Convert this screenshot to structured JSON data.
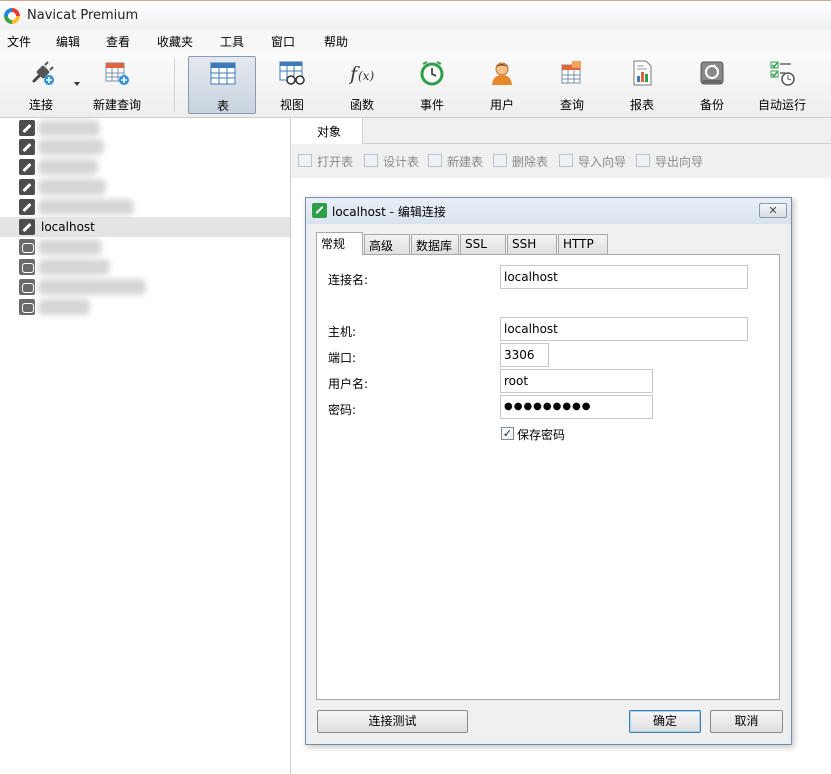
{
  "window": {
    "title": "Navicat Premium"
  },
  "menu": [
    "文件",
    "编辑",
    "查看",
    "收藏夹",
    "工具",
    "窗口",
    "帮助"
  ],
  "toolbar": {
    "connect": "连接",
    "new_query": "新建查询",
    "table": "表",
    "view": "视图",
    "function": "函数",
    "event": "事件",
    "user": "用户",
    "query": "查询",
    "report": "报表",
    "backup": "备份",
    "auto_run": "自动运行",
    "active": "表"
  },
  "tree": {
    "selected_label": "localhost"
  },
  "objects": {
    "tab": "对象",
    "tools": [
      "打开表",
      "设计表",
      "新建表",
      "删除表",
      "导入向导",
      "导出向导"
    ]
  },
  "dialog": {
    "title": "localhost - 编辑连接",
    "close_glyph": "✕",
    "tabs": [
      "常规",
      "高级",
      "数据库",
      "SSL",
      "SSH",
      "HTTP"
    ],
    "active_tab": "常规",
    "fields": {
      "connection_name_label": "连接名:",
      "connection_name_value": "localhost",
      "host_label": "主机:",
      "host_value": "localhost",
      "port_label": "端口:",
      "port_value": "3306",
      "username_label": "用户名:",
      "username_value": "root",
      "password_label": "密码:",
      "password_value": "●●●●●●●●●"
    },
    "save_password": {
      "label": "保存密码",
      "checked": true,
      "glyph": "✓"
    },
    "buttons": {
      "test": "连接测试",
      "ok": "确定",
      "cancel": "取消"
    }
  },
  "colors": {
    "selection": "#e4e4e4",
    "dialog_frame": "#7d8ea3",
    "accent_blue": "#3c7fb1"
  }
}
